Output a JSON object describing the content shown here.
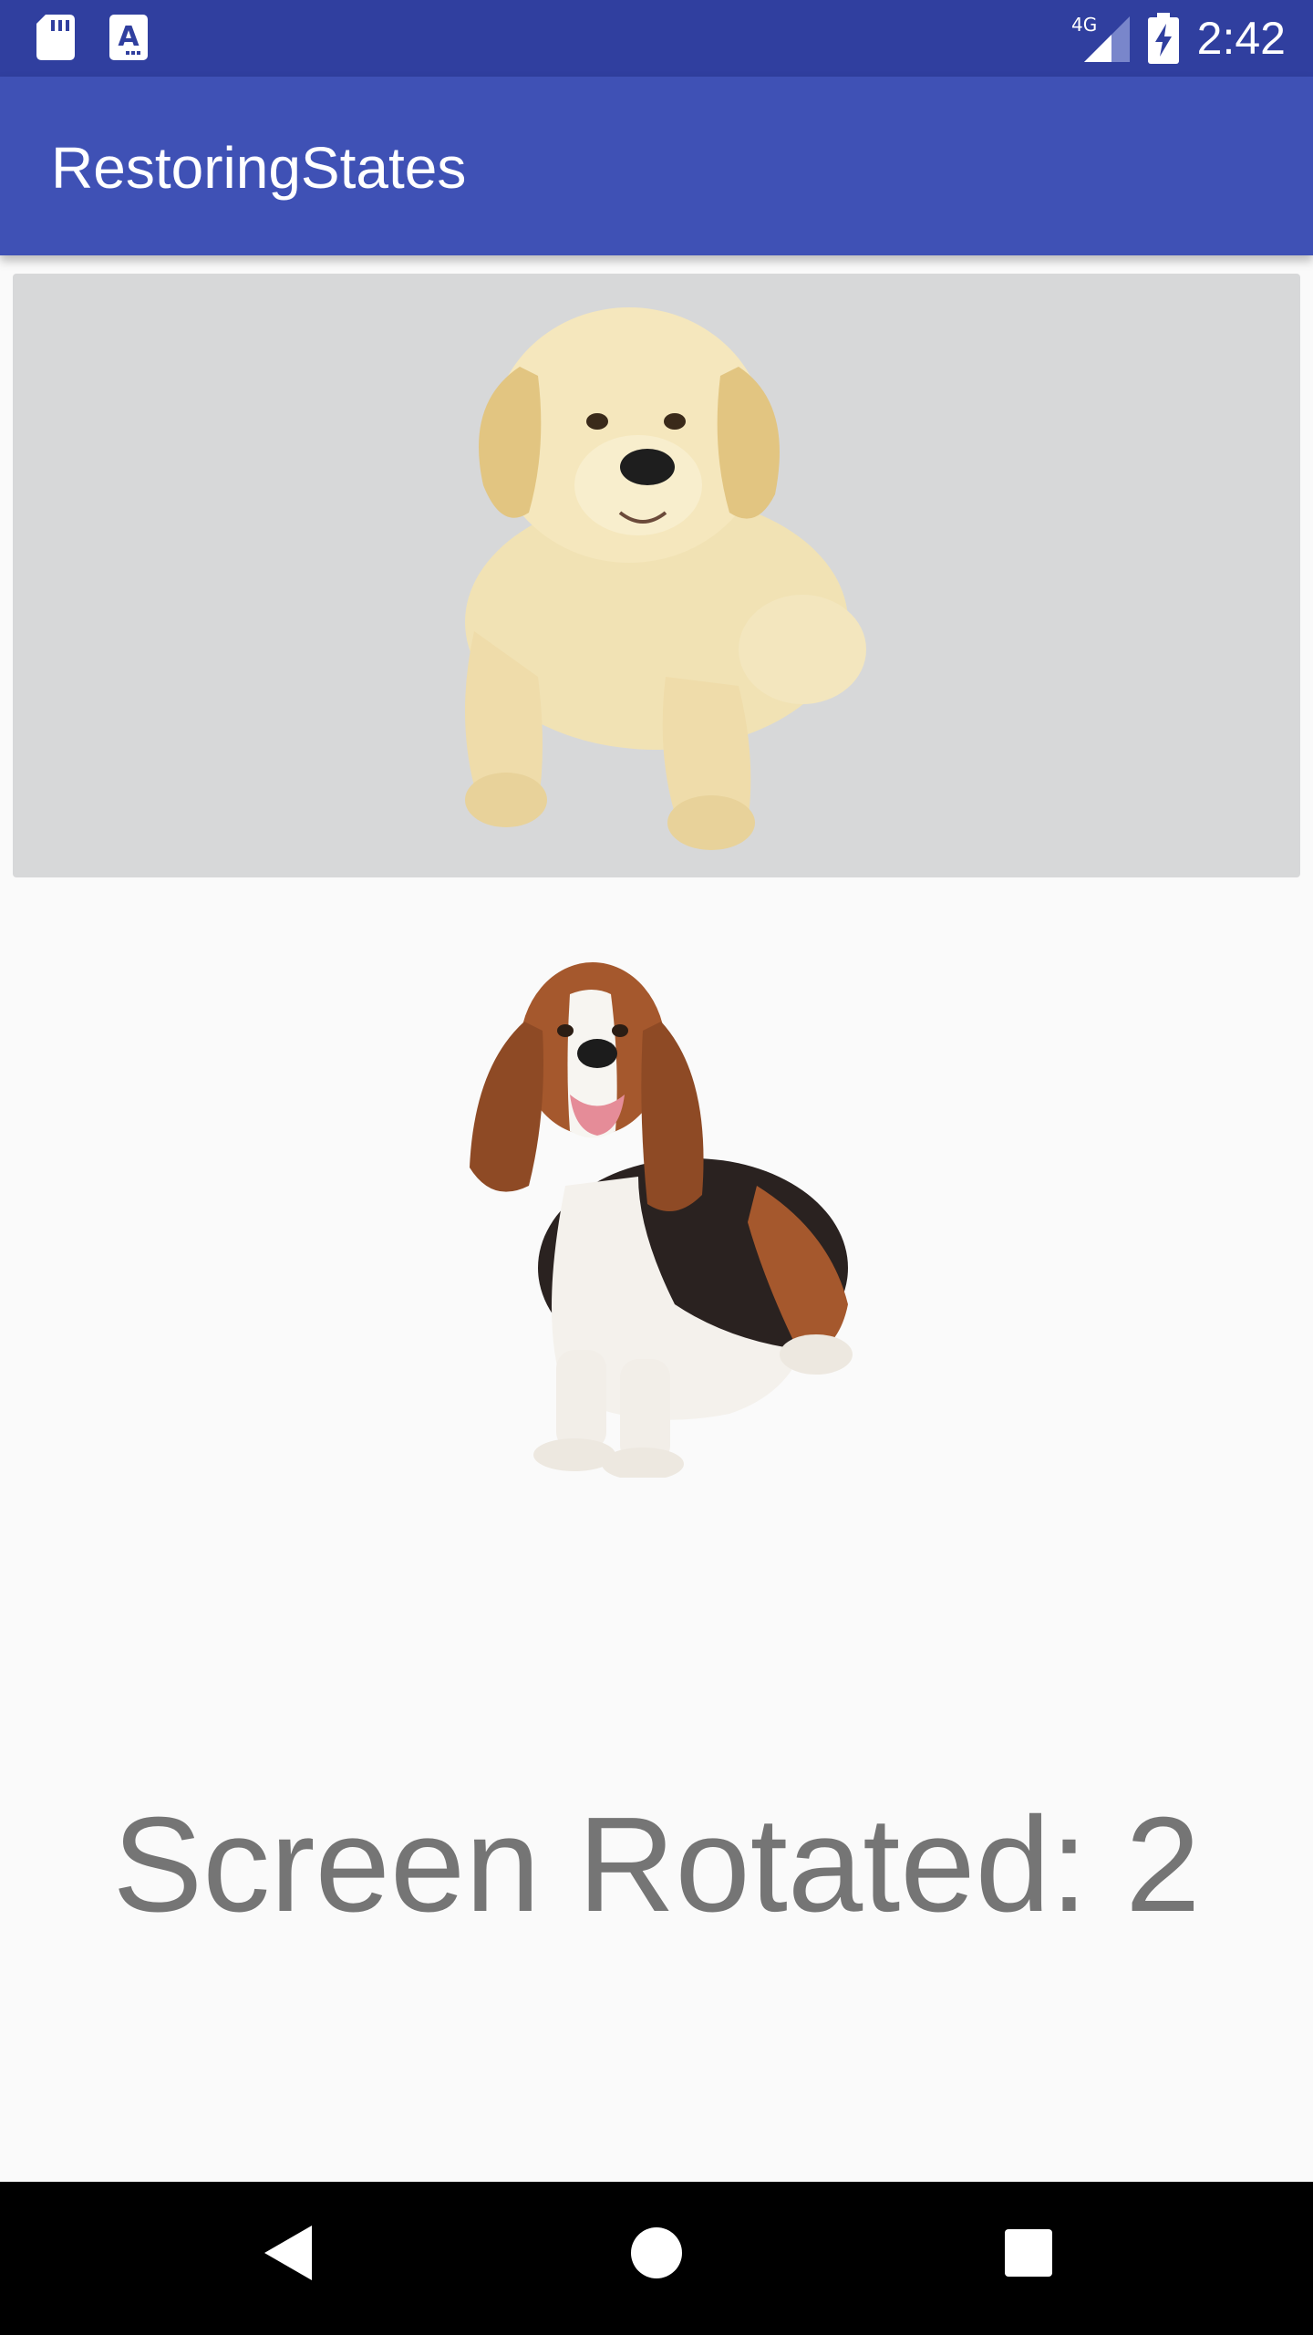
{
  "status_bar": {
    "time": "2:42",
    "network": "4G",
    "icons": [
      "sd-card-icon",
      "accessibility-a-icon",
      "signal-4g-icon",
      "battery-charging-icon"
    ],
    "color": "#303f9f"
  },
  "app_bar": {
    "title": "RestoringStates",
    "color": "#3f51b5"
  },
  "images": [
    {
      "name": "golden-retriever-puppy-image"
    },
    {
      "name": "basset-hound-image"
    }
  ],
  "counter": {
    "text": "Screen Rotated: 2"
  },
  "nav_bar": {
    "icons": [
      "back-icon",
      "home-icon",
      "recents-icon"
    ]
  }
}
